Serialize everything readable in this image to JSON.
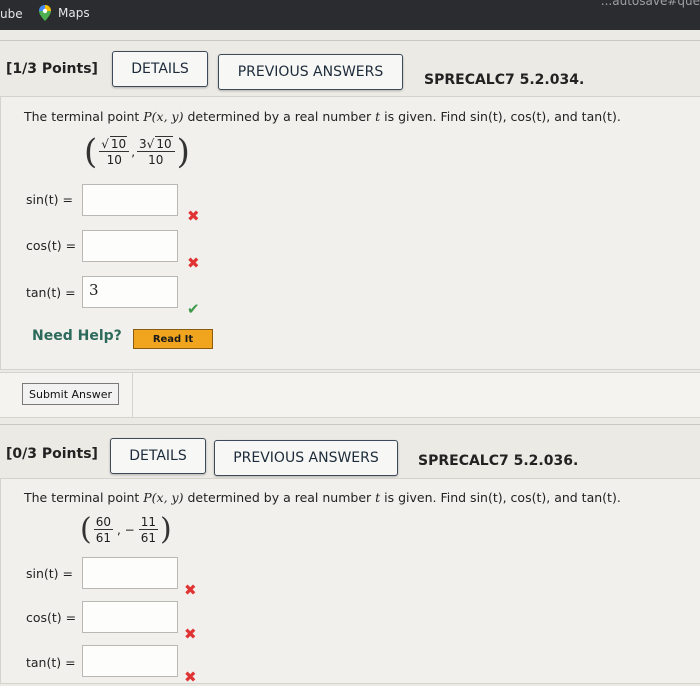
{
  "browser": {
    "tab_youtube": "ube",
    "tab_maps": "Maps",
    "url_fragment": "...autosave#que"
  },
  "q1": {
    "points": "[1/3 Points]",
    "details_label": "DETAILS",
    "prev_answers_label": "PREVIOUS ANSWERS",
    "code": "SPRECALC7 5.2.034.",
    "question_prefix": "The terminal point ",
    "question_point": "P(x, y)",
    "question_mid": " determined by a real number ",
    "question_t": "t",
    "question_suffix": " is given. Find sin(t), cos(t), and tan(t).",
    "frac1_num": "10",
    "frac1_den": "10",
    "frac2_num_coef": "3",
    "frac2_num_rad": "10",
    "frac2_den": "10",
    "sin_label": "sin(t) =",
    "cos_label": "cos(t) =",
    "tan_label": "tan(t) =",
    "sin_value": "",
    "cos_value": "",
    "tan_value": "3",
    "need_help": "Need Help?",
    "read_it": "Read It"
  },
  "submit_label": "Submit Answer",
  "q2": {
    "points": "[0/3 Points]",
    "details_label": "DETAILS",
    "prev_answers_label": "PREVIOUS ANSWERS",
    "code": "SPRECALC7 5.2.036.",
    "question_prefix": "The terminal point ",
    "question_point": "P(x, y)",
    "question_mid": " determined by a real number ",
    "question_t": "t",
    "question_suffix": " is given. Find sin(t), cos(t), and tan(t).",
    "frac1_num": "60",
    "frac1_den": "61",
    "sep": ", −",
    "frac2_num": "11",
    "frac2_den": "61",
    "sin_label": "sin(t) =",
    "cos_label": "cos(t) =",
    "tan_label": "tan(t) =",
    "sin_value": "",
    "cos_value": "",
    "tan_value": ""
  },
  "marks": {
    "wrong": "✖",
    "right": "✔"
  },
  "colors": {
    "wrong": "#e03434",
    "right": "#3e9a4a",
    "need_help": "#2d6a5c",
    "read_it": "#f1a51e"
  }
}
